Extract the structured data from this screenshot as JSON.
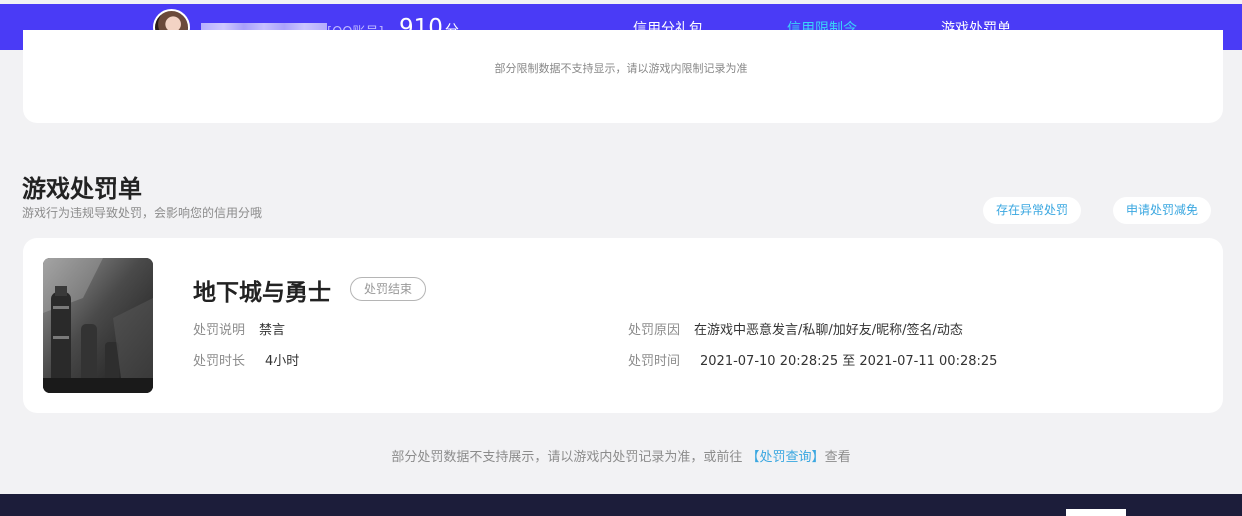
{
  "header": {
    "account_type": "[QQ账号]",
    "score": "910",
    "score_unit": "分",
    "tabs": [
      {
        "label": "信用分礼包"
      },
      {
        "label": "信用限制令"
      },
      {
        "label": "游戏处罚单"
      }
    ],
    "active_tab": "信用限制令",
    "colors": {
      "bar": "#4a3bf6",
      "active": "#3ad4f8"
    }
  },
  "limit_section": {
    "note": "部分限制数据不支持显示，请以游戏内限制记录为准"
  },
  "penalty_section": {
    "title": "游戏处罚单",
    "subtitle": "游戏行为违规导致处罚，会影响您的信用分哦",
    "actions": {
      "abnormal": "存在异常处罚",
      "appeal": "申请处罚减免"
    },
    "item": {
      "game": "地下城与勇士",
      "status": "处罚结束",
      "reason_label": "处罚说明",
      "reason_value": "禁言",
      "duration_label": "处罚时长",
      "duration_value": "4小时",
      "cause_label": "处罚原因",
      "cause_value": "在游戏中恶意发言/私聊/加好友/昵称/签名/动态",
      "time_label": "处罚时间",
      "time_value": "2021-07-10 20:28:25 至 2021-07-11 00:28:25"
    },
    "bottom_note_prefix": "部分处罚数据不支持展示，请以游戏内处罚记录为准，或前往 ",
    "bottom_note_link": "【处罚查询】",
    "bottom_note_suffix": "查看"
  }
}
